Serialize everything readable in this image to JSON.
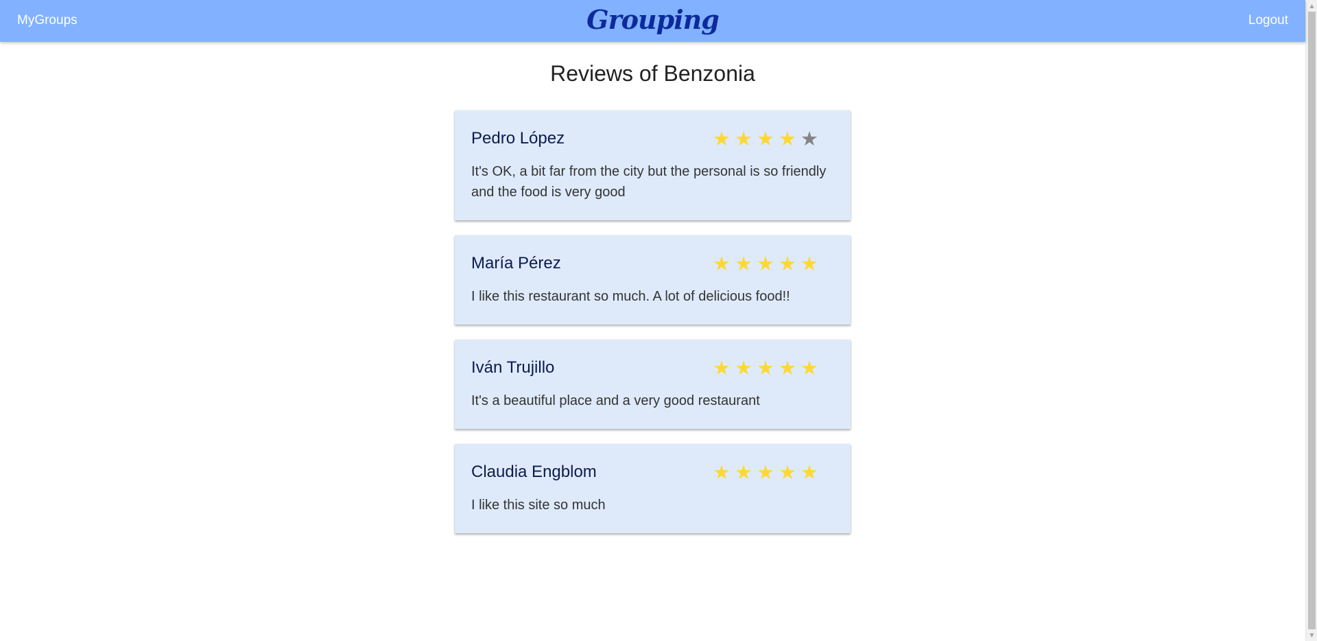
{
  "header": {
    "left_link": "MyGroups",
    "brand": "Grouping",
    "right_link": "Logout",
    "bar_color": "#82b1ff"
  },
  "page": {
    "title": "Reviews of Benzonia"
  },
  "reviews": [
    {
      "author": "Pedro López",
      "rating": 4,
      "max_rating": 5,
      "text": "It's OK, a bit far from the city but the personal is so friendly and the food is very good"
    },
    {
      "author": "María Pérez",
      "rating": 5,
      "max_rating": 5,
      "text": "I like this restaurant so much. A lot of delicious food!!"
    },
    {
      "author": "Iván Trujillo",
      "rating": 5,
      "max_rating": 5,
      "text": "It's a beautiful place and a very good restaurant"
    },
    {
      "author": "Claudia Engblom",
      "rating": 5,
      "max_rating": 5,
      "text": "I like this site so much"
    }
  ],
  "colors": {
    "card_background": "#deeafa",
    "star_filled": "#fdd835",
    "star_empty": "#848484",
    "brand_text": "#0d2a9c"
  },
  "icons": {
    "star": "star-icon",
    "scroll_up": "chevron-up-icon",
    "scroll_down": "chevron-down-icon"
  }
}
